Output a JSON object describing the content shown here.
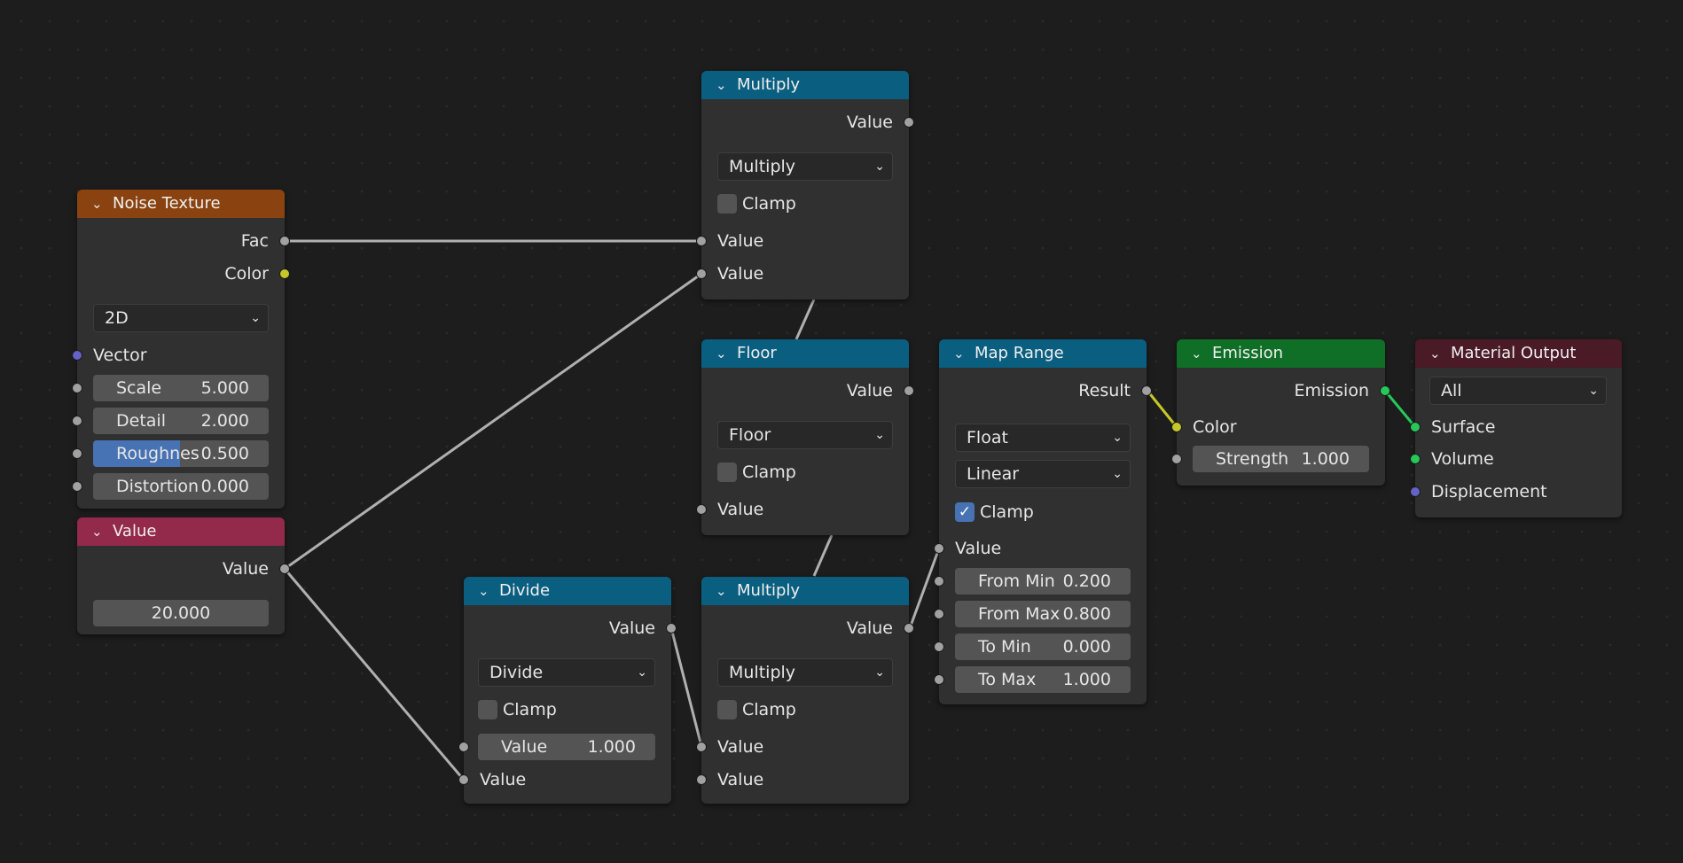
{
  "nodes": {
    "noise": {
      "title": "Noise Texture",
      "color": "#8a4310",
      "out_fac": "Fac",
      "out_color": "Color",
      "dimension": "2D",
      "in_vector": "Vector",
      "scale_label": "Scale",
      "scale_value": "5.000",
      "detail_label": "Detail",
      "detail_value": "2.000",
      "roughness_label": "Roughnes",
      "roughness_value": "0.500",
      "roughness_fill": 0.5,
      "distortion_label": "Distortion",
      "distortion_value": "0.000"
    },
    "value": {
      "title": "Value",
      "color": "#93294b",
      "out_value": "Value",
      "value": "20.000"
    },
    "multiply_top": {
      "title": "Multiply",
      "color": "#0a5f80",
      "out_value": "Value",
      "operation": "Multiply",
      "clamp_label": "Clamp",
      "clamp": false,
      "in_value_1": "Value",
      "in_value_2": "Value"
    },
    "floor": {
      "title": "Floor",
      "color": "#0a5f80",
      "out_value": "Value",
      "operation": "Floor",
      "clamp_label": "Clamp",
      "clamp": false,
      "in_value": "Value"
    },
    "map_range": {
      "title": "Map Range",
      "color": "#0a5f80",
      "out_result": "Result",
      "data_type": "Float",
      "interpolation": "Linear",
      "clamp_label": "Clamp",
      "clamp": true,
      "in_value": "Value",
      "from_min_label": "From Min",
      "from_min_value": "0.200",
      "from_max_label": "From Max",
      "from_max_value": "0.800",
      "to_min_label": "To Min",
      "to_min_value": "0.000",
      "to_max_label": "To Max",
      "to_max_value": "1.000"
    },
    "emission": {
      "title": "Emission",
      "color": "#0f6f27",
      "out_emission": "Emission",
      "in_color": "Color",
      "strength_label": "Strength",
      "strength_value": "1.000"
    },
    "material_output": {
      "title": "Material Output",
      "color": "#4a1a27",
      "target": "All",
      "in_surface": "Surface",
      "in_volume": "Volume",
      "in_displacement": "Displacement"
    },
    "divide": {
      "title": "Divide",
      "color": "#0a5f80",
      "out_value": "Value",
      "operation": "Divide",
      "clamp_label": "Clamp",
      "clamp": false,
      "value_field_label": "Value",
      "value_field_value": "1.000",
      "in_value": "Value"
    },
    "multiply_bottom": {
      "title": "Multiply",
      "color": "#0a5f80",
      "out_value": "Value",
      "operation": "Multiply",
      "clamp_label": "Clamp",
      "clamp": false,
      "in_value_1": "Value",
      "in_value_2": "Value"
    }
  },
  "icons": {
    "collapse": "chevron-down-icon",
    "dropdown": "chevron-down-icon",
    "check": "checkmark-icon"
  },
  "colors": {
    "socket_float": "#a1a1a1",
    "socket_color": "#c7c729",
    "socket_vector": "#6363c7",
    "socket_shader": "#27c75a",
    "link_default": "#a8a8a8"
  }
}
